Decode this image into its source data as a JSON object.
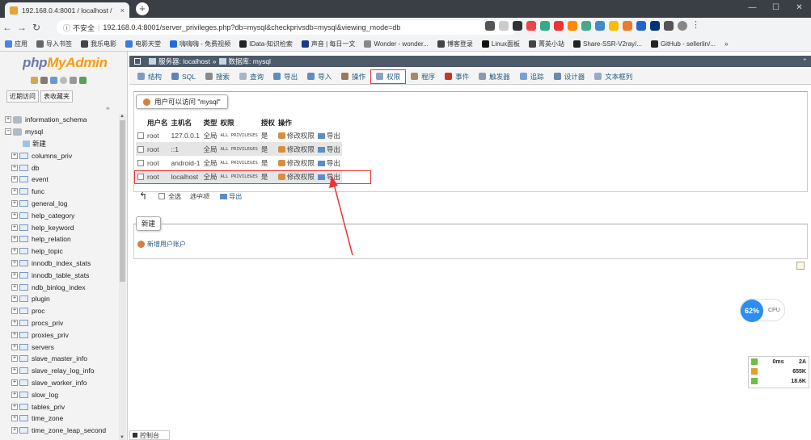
{
  "browser": {
    "tab_title": "192.168.0.4:8001 / localhost /",
    "tab_close": "×",
    "new_tab": "+",
    "security": "不安全",
    "url": "192.168.0.4:8001/server_privileges.php?db=mysql&checkprivsdb=mysql&viewing_mode=db",
    "bookmarks": [
      "应用",
      "导入书签",
      "我乐电影",
      "电影天堂",
      "嗨嗨嗨 - 免费视频",
      "IData-知识检索",
      "声音 | 每日一文",
      "Wonder - wonder...",
      "博客登录",
      "Linux面板",
      "菁英小站",
      "Share-SSR-V2ray/...",
      "GitHub - sellerlin/..."
    ],
    "more": "»"
  },
  "sidebar": {
    "logo_main": "php",
    "logo_accent": "MyAdmin",
    "tabs": [
      "近期访问",
      "表收藏夹"
    ],
    "tree": [
      {
        "label": "information_schema",
        "type": "db",
        "exp": "+"
      },
      {
        "label": "mysql",
        "type": "db",
        "exp": "−"
      },
      {
        "label": "新建",
        "type": "new"
      },
      {
        "label": "columns_priv",
        "type": "table"
      },
      {
        "label": "db",
        "type": "table"
      },
      {
        "label": "event",
        "type": "table"
      },
      {
        "label": "func",
        "type": "table"
      },
      {
        "label": "general_log",
        "type": "table"
      },
      {
        "label": "help_category",
        "type": "table"
      },
      {
        "label": "help_keyword",
        "type": "table"
      },
      {
        "label": "help_relation",
        "type": "table"
      },
      {
        "label": "help_topic",
        "type": "table"
      },
      {
        "label": "innodb_index_stats",
        "type": "table"
      },
      {
        "label": "innodb_table_stats",
        "type": "table"
      },
      {
        "label": "ndb_binlog_index",
        "type": "table"
      },
      {
        "label": "plugin",
        "type": "table"
      },
      {
        "label": "proc",
        "type": "table"
      },
      {
        "label": "procs_priv",
        "type": "table"
      },
      {
        "label": "proxies_priv",
        "type": "table"
      },
      {
        "label": "servers",
        "type": "table"
      },
      {
        "label": "slave_master_info",
        "type": "table"
      },
      {
        "label": "slave_relay_log_info",
        "type": "table"
      },
      {
        "label": "slave_worker_info",
        "type": "table"
      },
      {
        "label": "slow_log",
        "type": "table"
      },
      {
        "label": "tables_priv",
        "type": "table"
      },
      {
        "label": "time_zone",
        "type": "table"
      },
      {
        "label": "time_zone_leap_second",
        "type": "table"
      }
    ]
  },
  "breadcrumb": {
    "server": "服务器: localhost",
    "sep": "»",
    "db": "数据库: mysql",
    "collapse": "⌃"
  },
  "menu": [
    {
      "label": "结构",
      "color": "#7a9cc6"
    },
    {
      "label": "SQL",
      "color": "#5c84b8"
    },
    {
      "label": "搜索",
      "color": "#8a8a8a"
    },
    {
      "label": "查询",
      "color": "#a9b6c6"
    },
    {
      "label": "导出",
      "color": "#5a8ec5"
    },
    {
      "label": "导入",
      "color": "#5a8ec5"
    },
    {
      "label": "操作",
      "color": "#9a7a5a"
    },
    {
      "label": "权限",
      "color": "#8aa0c0",
      "active": true
    },
    {
      "label": "程序",
      "color": "#a58a6a"
    },
    {
      "label": "事件",
      "color": "#c0392b"
    },
    {
      "label": "触发器",
      "color": "#8a9ab0"
    },
    {
      "label": "追踪",
      "color": "#7aa0d0"
    },
    {
      "label": "设计器",
      "color": "#6a88b0"
    },
    {
      "label": "文本框列",
      "color": "#9aaac0"
    }
  ],
  "privileges": {
    "legend": "用户可以访问 \"mysql\"",
    "headers": [
      "用户名",
      "主机名",
      "类型",
      "权限",
      "授权",
      "操作"
    ],
    "rows": [
      {
        "user": "root",
        "host": "127.0.0.1",
        "type": "全局",
        "priv": "ALL PRIVILEGES",
        "grant": "是",
        "edit": "修改权限",
        "export": "导出"
      },
      {
        "user": "root",
        "host": "::1",
        "type": "全局",
        "priv": "ALL PRIVILEGES",
        "grant": "是",
        "edit": "修改权限",
        "export": "导出"
      },
      {
        "user": "root",
        "host": "android-1",
        "type": "全局",
        "priv": "ALL PRIVILEGES",
        "grant": "是",
        "edit": "修改权限",
        "export": "导出"
      },
      {
        "user": "root",
        "host": "localhost",
        "type": "全局",
        "priv": "ALL PRIVILEGES",
        "grant": "是",
        "edit": "修改权限",
        "export": "导出"
      }
    ],
    "check_all": "全选",
    "with_selected": "选中项:",
    "export": "导出"
  },
  "new_section": {
    "legend": "新建",
    "add_user": "新增用户账户"
  },
  "console": "控制台",
  "monitor": {
    "cpu_percent": "62%",
    "cpu_label": "CPU",
    "net_rows": [
      {
        "a": "0ms",
        "b": "2A"
      },
      {
        "a": "",
        "b": "655K"
      },
      {
        "a": "",
        "b": "18.6K"
      }
    ]
  }
}
